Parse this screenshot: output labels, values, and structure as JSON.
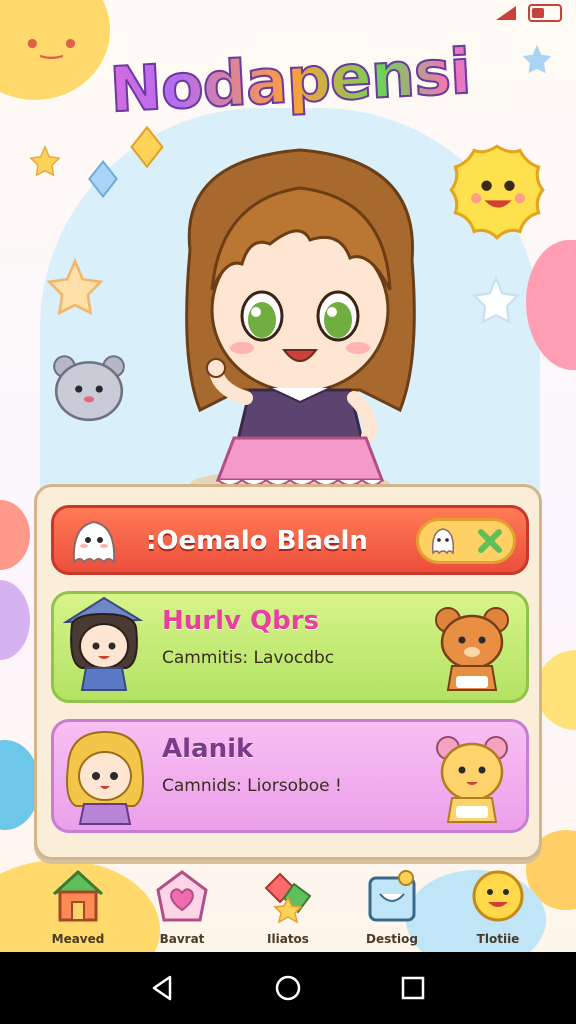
{
  "app": {
    "title": "Nodapensi"
  },
  "status_bar": {
    "icons": [
      "signal-icon",
      "battery-icon"
    ]
  },
  "panel": {
    "rows": [
      {
        "title": ":Oemalo Blaeln",
        "subtitle": "",
        "color": "#ec4f3c"
      },
      {
        "title": "Hurlv Qbrs",
        "subtitle": "Cammitis: Lavocdbc",
        "color": "#b3e264"
      },
      {
        "title": "Alanik",
        "subtitle": "Camnids: Liorsoboe !",
        "color": "#eaa0ea"
      }
    ]
  },
  "bottom_nav": {
    "items": [
      {
        "label": "Meaved",
        "icon": "house-icon"
      },
      {
        "label": "Bavrat",
        "icon": "heart-frame-icon"
      },
      {
        "label": "Iliatos",
        "icon": "star-cluster-icon"
      },
      {
        "label": "Destiog",
        "icon": "frame-icon"
      },
      {
        "label": "Tlotiie",
        "icon": "smiley-icon"
      }
    ]
  },
  "system_nav": {
    "buttons": [
      "back-icon",
      "home-icon",
      "recents-icon"
    ]
  },
  "colors": {
    "accent": "#e8409c",
    "panel": "#fbeed8",
    "sky": "#d9f0fb"
  }
}
